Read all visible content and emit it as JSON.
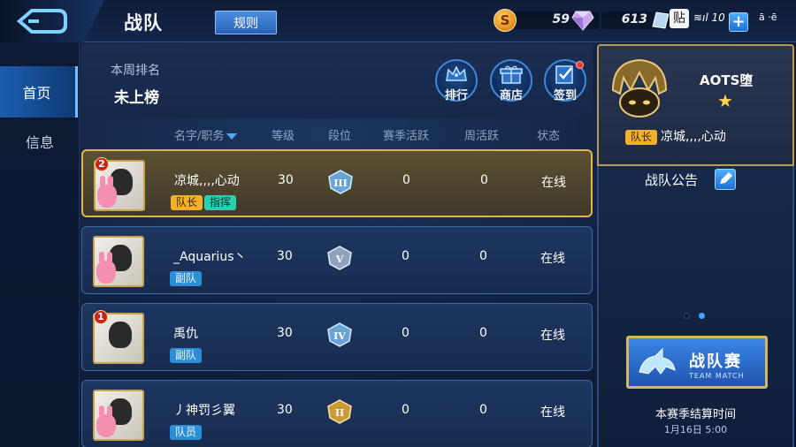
{
  "header": {
    "title": "战队",
    "rules_label": "规则",
    "gold_icon_letter": "S",
    "gold": "59",
    "diamonds": "613",
    "paste_label": "贴",
    "status_text": "≋ıl 10",
    "status_icons": "ā ·ē",
    "plus_label": "+"
  },
  "sidebar": {
    "items": [
      {
        "label": "首页"
      },
      {
        "label": "信息"
      }
    ]
  },
  "ranking": {
    "label": "本周排名",
    "value": "未上榜",
    "buttons": [
      {
        "label": "排行",
        "icon": "crown-icon"
      },
      {
        "label": "商店",
        "icon": "gift-icon"
      },
      {
        "label": "签到",
        "icon": "checkin-icon"
      }
    ]
  },
  "columns": {
    "name": "名字/职务",
    "level": "等级",
    "tier": "段位",
    "season_activity": "赛季活跃",
    "week_activity": "周活跃",
    "status": "状态"
  },
  "members": [
    {
      "badge": "2",
      "name": "凉城,,,,心动",
      "roles": [
        "队长",
        "指挥"
      ],
      "level": "30",
      "tier": "III",
      "season": "0",
      "week": "0",
      "status": "在线"
    },
    {
      "badge": "",
      "name": "_Aquarius丶",
      "roles": [
        "副队"
      ],
      "level": "30",
      "tier": "V",
      "season": "0",
      "week": "0",
      "status": "在线"
    },
    {
      "badge": "1",
      "name": "禹仇",
      "roles": [
        "副队"
      ],
      "level": "30",
      "tier": "IV",
      "season": "0",
      "week": "0",
      "status": "在线"
    },
    {
      "badge": "",
      "name": "丿神罚彡翼",
      "roles": [
        "队员"
      ],
      "level": "30",
      "tier": "II",
      "season": "0",
      "week": "0",
      "status": "在线"
    }
  ],
  "team": {
    "name": "AOTS堕",
    "captain_tag": "队长",
    "captain_name": "凉城,,,,心动",
    "notice_label": "战队公告",
    "match_title": "战队赛",
    "match_sub": "TEAM MATCH",
    "settle_label": "本赛季结算时间",
    "settle_date": "1月16日 5:00"
  },
  "colors": {
    "accent": "#3f86d6",
    "gold_border": "#e3b449",
    "captain_tag": "#f2b02b",
    "commander_tag": "#2ad0b1",
    "member_tag": "#2c8fd6"
  }
}
